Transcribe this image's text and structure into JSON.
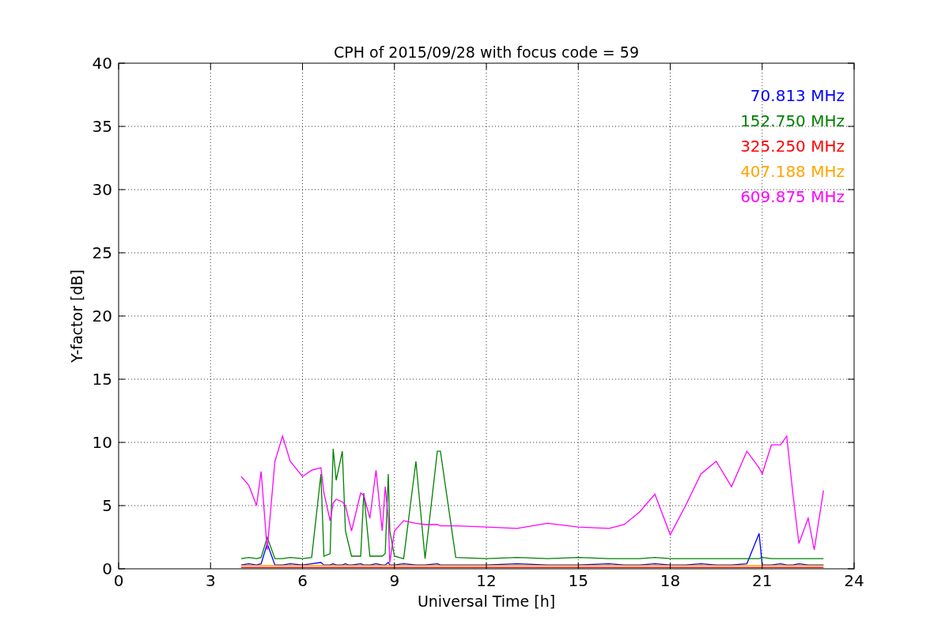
{
  "chart_data": {
    "type": "line",
    "title": "CPH of 2015/09/28 with focus code = 59",
    "xlabel": "Universal Time [h]",
    "ylabel": "Y-factor [dB]",
    "x": [
      4,
      4.25,
      4.5,
      4.65,
      4.85,
      5.1,
      5.35,
      5.6,
      6,
      6.3,
      6.6,
      6.7,
      6.9,
      7,
      7.1,
      7.3,
      7.4,
      7.5,
      7.6,
      7.9,
      8.0,
      8.2,
      8.4,
      8.6,
      8.7,
      8.8,
      8.85,
      9,
      9.3,
      9.7,
      10,
      10.4,
      10.5,
      11,
      12,
      13,
      14,
      15,
      16,
      16.5,
      17,
      17.5,
      18,
      18.5,
      19,
      19.5,
      20,
      20.5,
      20.9,
      21,
      21.3,
      21.6,
      21.8,
      22,
      22.2,
      22.5,
      22.7,
      23
    ],
    "grid": true,
    "xlim": [
      0,
      24
    ],
    "ylim": [
      0,
      40
    ],
    "xticks": [
      0,
      3,
      6,
      9,
      12,
      15,
      18,
      21,
      24
    ],
    "yticks": [
      0,
      5,
      10,
      15,
      20,
      25,
      30,
      35,
      40
    ],
    "series": [
      {
        "name": "70.813 MHz",
        "color": "#0000ff",
        "values": [
          0.3,
          0.4,
          0.3,
          0.4,
          2.0,
          0.3,
          0.3,
          0.4,
          0.3,
          0.4,
          0.5,
          0.3,
          0.3,
          0.4,
          0.3,
          0.3,
          0.4,
          0.3,
          0.3,
          0.4,
          0.3,
          0.3,
          0.4,
          0.3,
          0.3,
          0.5,
          0.3,
          0.3,
          0.4,
          0.3,
          0.3,
          0.4,
          0.3,
          0.3,
          0.3,
          0.4,
          0.3,
          0.3,
          0.4,
          0.3,
          0.3,
          0.4,
          0.3,
          0.3,
          0.4,
          0.3,
          0.3,
          0.4,
          2.8,
          0.3,
          0.3,
          0.4,
          0.3,
          0.3,
          0.4,
          0.3,
          0.3,
          0.3
        ]
      },
      {
        "name": "152.750 MHz",
        "color": "#008000",
        "values": [
          0.8,
          0.9,
          0.8,
          0.9,
          2.5,
          0.8,
          0.8,
          0.9,
          0.8,
          0.9,
          7.5,
          1.0,
          1.2,
          9.5,
          7.0,
          9.3,
          3.0,
          2.0,
          1.0,
          1.0,
          6.0,
          1.0,
          1.0,
          1.0,
          1.2,
          7.5,
          3.0,
          1.0,
          0.8,
          8.5,
          0.8,
          9.3,
          9.3,
          0.9,
          0.8,
          0.9,
          0.8,
          0.9,
          0.8,
          0.8,
          0.8,
          0.9,
          0.8,
          0.8,
          0.8,
          0.8,
          0.8,
          0.8,
          0.8,
          0.9,
          0.8,
          0.8,
          0.8,
          0.8,
          0.8,
          0.8,
          0.8,
          0.8
        ]
      },
      {
        "name": "325.250 MHz",
        "color": "#ff0000",
        "values": [
          0.1,
          0.1,
          0.1,
          0.1,
          0.1,
          0.1,
          0.1,
          0.1,
          0.1,
          0.1,
          0.1,
          0.1,
          0.1,
          0.1,
          0.1,
          0.1,
          0.1,
          0.1,
          0.1,
          0.1,
          0.1,
          0.1,
          0.1,
          0.1,
          0.1,
          0.1,
          0.1,
          0.1,
          0.1,
          0.1,
          0.1,
          0.1,
          0.1,
          0.1,
          0.1,
          0.1,
          0.1,
          0.1,
          0.1,
          0.1,
          0.1,
          0.1,
          0.1,
          0.1,
          0.1,
          0.1,
          0.1,
          0.1,
          0.1,
          0.1,
          0.1,
          0.1,
          0.1,
          0.1,
          0.1,
          0.1,
          0.1,
          0.1
        ]
      },
      {
        "name": "407.188 MHz",
        "color": "#ffa500",
        "values": [
          0.25,
          0.25,
          0.25,
          0.25,
          0.25,
          0.25,
          0.25,
          0.25,
          0.25,
          0.25,
          0.25,
          0.25,
          0.25,
          0.25,
          0.25,
          0.25,
          0.25,
          0.25,
          0.25,
          0.25,
          0.25,
          0.25,
          0.25,
          0.25,
          0.25,
          0.25,
          0.25,
          0.25,
          0.25,
          0.25,
          0.25,
          0.25,
          0.25,
          0.25,
          0.25,
          0.25,
          0.25,
          0.25,
          0.25,
          0.25,
          0.25,
          0.25,
          0.25,
          0.25,
          0.25,
          0.25,
          0.25,
          0.25,
          0.25,
          0.25,
          0.25,
          0.25,
          0.25,
          0.25,
          0.25,
          0.25,
          0.25,
          0.25
        ]
      },
      {
        "name": "609.875 MHz",
        "color": "#ff00ff",
        "values": [
          7.3,
          6.6,
          5.0,
          7.7,
          1.5,
          8.5,
          10.5,
          8.5,
          7.3,
          7.8,
          8.0,
          6.0,
          3.8,
          5.2,
          5.5,
          5.3,
          5.0,
          4.0,
          3.0,
          6.0,
          5.8,
          4.0,
          7.8,
          3.0,
          6.5,
          4.0,
          0.5,
          3.0,
          3.8,
          3.6,
          3.5,
          3.5,
          3.4,
          3.4,
          3.3,
          3.2,
          3.6,
          3.3,
          3.2,
          3.5,
          4.5,
          5.9,
          2.7,
          5.0,
          7.5,
          8.5,
          6.5,
          9.3,
          8.0,
          7.5,
          9.8,
          9.8,
          10.5,
          6.0,
          2.0,
          4.0,
          1.5,
          6.2
        ]
      }
    ]
  }
}
